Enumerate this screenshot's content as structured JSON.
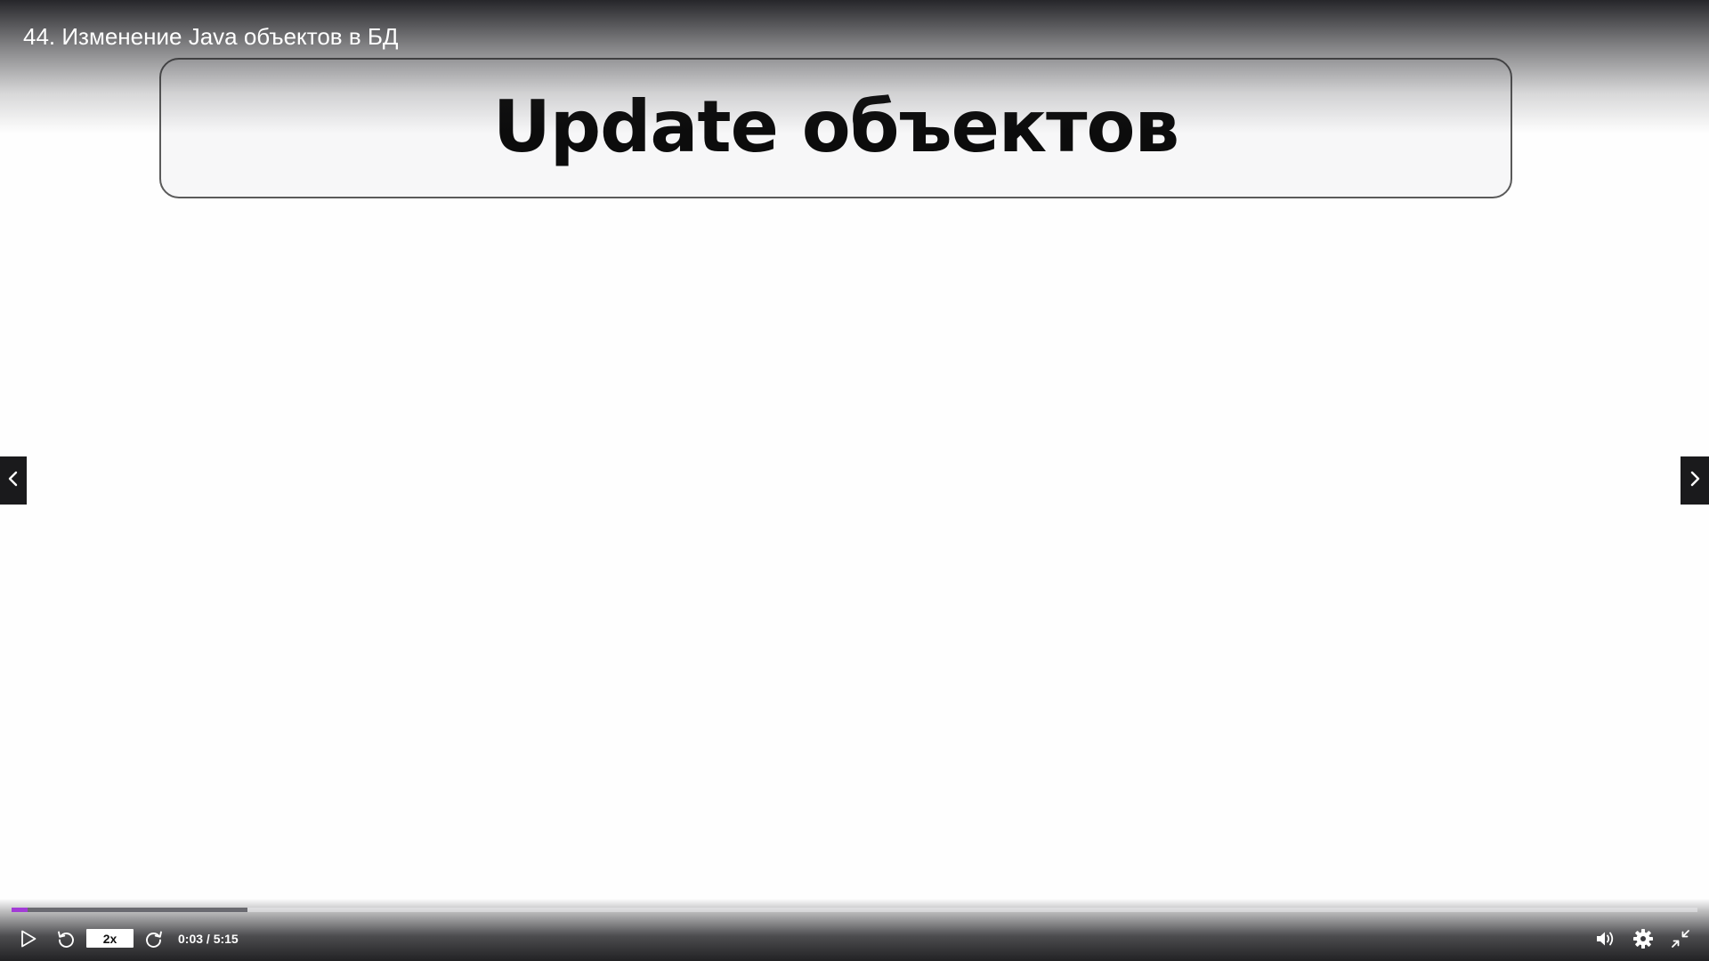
{
  "video": {
    "title": "44. Изменение Java объектов в БД"
  },
  "slide": {
    "heading": "Update объектов"
  },
  "player": {
    "progress_played_fraction": 0.0095,
    "progress_buffered_fraction": 0.14,
    "speed_label": "2x",
    "time_label": "0:03 / 5:15",
    "accent_color": "#a23bd6"
  },
  "icons": {
    "play": "play-icon",
    "rewind": "rewind-icon",
    "forward": "forward-icon",
    "volume": "volume-icon",
    "settings": "gear-icon",
    "exit_fullscreen": "exit-fullscreen-icon",
    "prev": "chevron-left-icon",
    "next": "chevron-right-icon"
  }
}
